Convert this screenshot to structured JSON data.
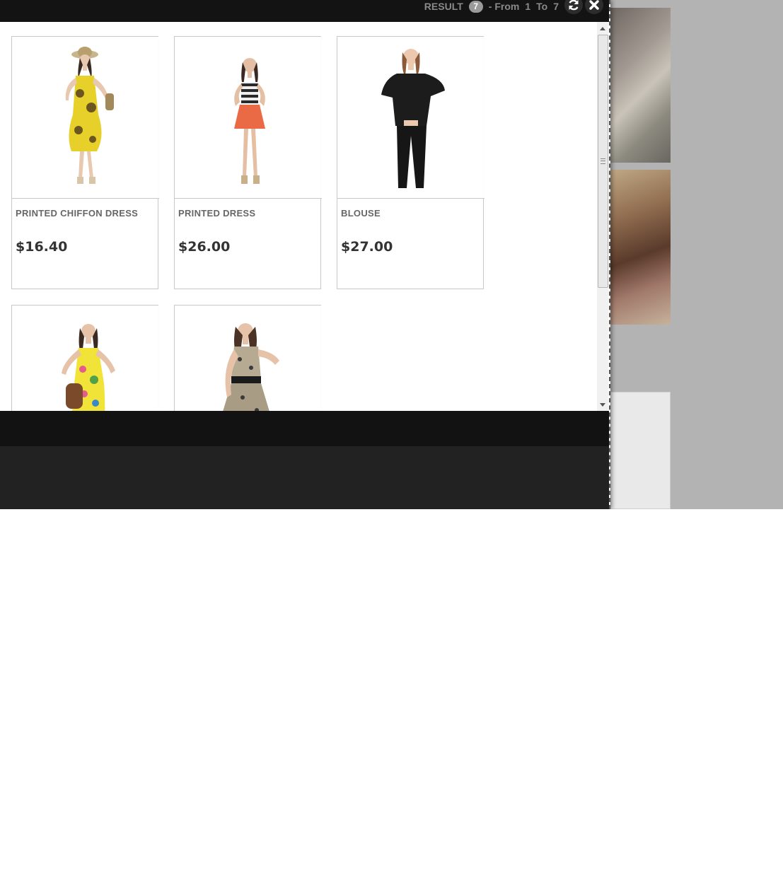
{
  "header": {
    "result_label": "RESULT",
    "result_count": "7",
    "from_label": "- From",
    "from_value": "1",
    "to_label": "To",
    "to_value": "7",
    "refresh_icon": "refresh-icon",
    "close_icon": "close-icon"
  },
  "products": [
    {
      "name": "PRINTED CHIFFON DRESS",
      "price": "$16.40",
      "image": "woman-yellow-chiffon-dress"
    },
    {
      "name": "PRINTED DRESS",
      "price": "$26.00",
      "image": "woman-striped-top-orange-skirt"
    },
    {
      "name": "BLOUSE",
      "price": "$27.00",
      "image": "woman-black-blouse"
    },
    {
      "name": "",
      "price": "",
      "image": "woman-yellow-floral-dress"
    },
    {
      "name": "",
      "price": "",
      "image": "woman-printed-dress-belt"
    }
  ],
  "colors": {
    "topbar": "#131313",
    "footer": "#121212",
    "footer_lower": "#222222",
    "overlay": "#b3b3b3",
    "badge": "#9a9a9a"
  }
}
